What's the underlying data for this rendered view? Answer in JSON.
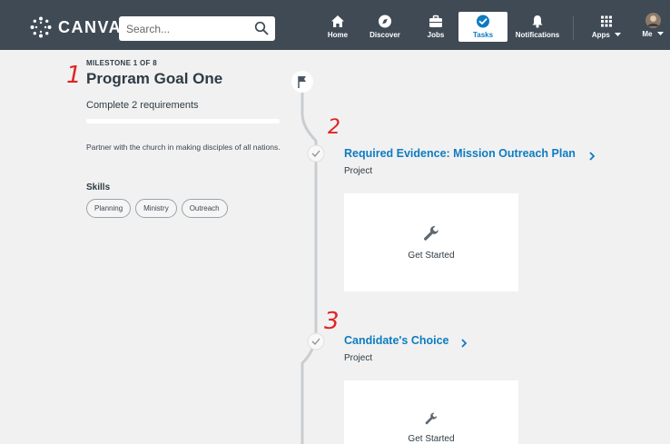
{
  "brand": {
    "name": "CANVAS"
  },
  "search": {
    "placeholder": "Search..."
  },
  "nav": {
    "items": [
      {
        "label": "Home",
        "icon": "home-icon"
      },
      {
        "label": "Discover",
        "icon": "compass-icon"
      },
      {
        "label": "Jobs",
        "icon": "briefcase-icon"
      },
      {
        "label": "Tasks",
        "icon": "check-circle-icon",
        "active": true
      },
      {
        "label": "Notifications",
        "icon": "bell-icon"
      },
      {
        "label": "Apps",
        "icon": "grid-icon"
      },
      {
        "label": "Me",
        "icon": "avatar"
      }
    ]
  },
  "milestone": {
    "counter": "MILESTONE 1 OF 8",
    "title": "Program Goal One",
    "requirements_text": "Complete 2 requirements",
    "progress": 0,
    "description": "Partner with the church in making disciples of all nations.",
    "skills_heading": "Skills",
    "skills": [
      "Planning",
      "Ministry",
      "Outreach"
    ]
  },
  "requirements": [
    {
      "title": "Required Evidence: Mission Outreach Plan",
      "type": "Project",
      "action": "Get Started"
    },
    {
      "title": "Candidate's Choice",
      "type": "Project",
      "action": "Get Started"
    }
  ],
  "annotations": [
    "1",
    "2",
    "3"
  ],
  "colors": {
    "nav_bg": "#3f4a55",
    "accent": "#0e7cc1",
    "annotation": "#e02424",
    "page_bg": "#f1f1f1"
  }
}
